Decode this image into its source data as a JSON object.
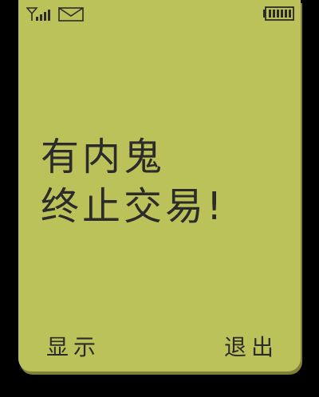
{
  "status_bar": {
    "signal_icon": "signal-strength-icon",
    "mail_icon": "envelope-icon",
    "battery_icon": "battery-full-icon"
  },
  "message": {
    "line1": "有内鬼",
    "line2": "终止交易!"
  },
  "softkeys": {
    "left_label": "显示",
    "right_label": "退出"
  },
  "colors": {
    "screen_bg": "#bcc25a",
    "text": "#2b2b2b",
    "frame": "#000000"
  }
}
